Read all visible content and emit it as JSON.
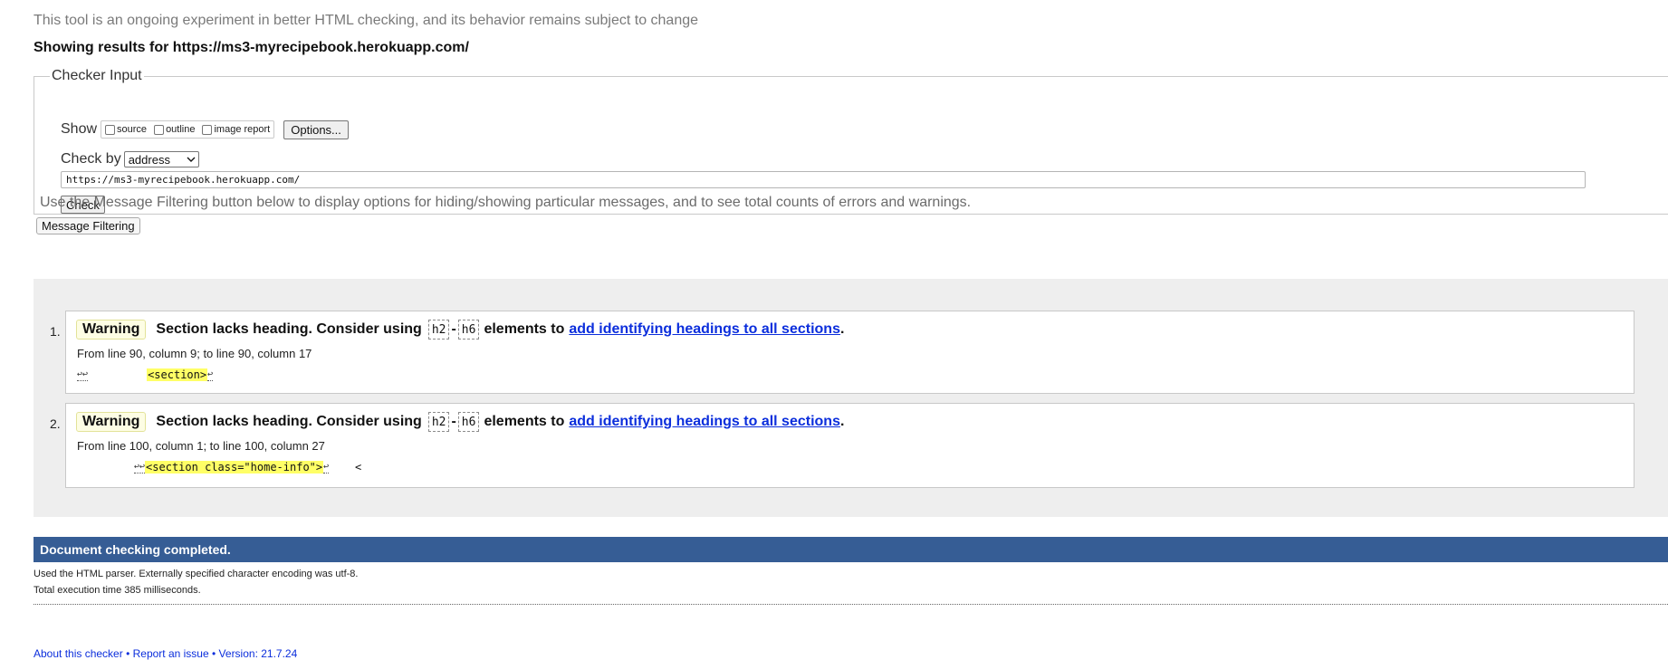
{
  "page": {
    "notice": "This tool is an ongoing experiment in better HTML checking, and its behavior remains subject to change",
    "results_for": "Showing results for https://ms3-myrecipebook.herokuapp.com/"
  },
  "checker": {
    "legend": "Checker Input",
    "show_label": "Show",
    "options": [
      {
        "label": "source",
        "checked": false
      },
      {
        "label": "outline",
        "checked": false
      },
      {
        "label": "image report",
        "checked": false
      }
    ],
    "options_button": "Options...",
    "check_by_label": "Check by",
    "check_by_value": "address",
    "url_value": "https://ms3-myrecipebook.herokuapp.com/",
    "check_button": "Check"
  },
  "filtering": {
    "hint": "Use the Message Filtering button below to display options for hiding/showing particular messages, and to see total counts of errors and warnings.",
    "button": "Message Filtering"
  },
  "messages": [
    {
      "number": "1.",
      "type": "Warning",
      "text_before": "Section lacks heading. Consider using",
      "code_a": "h2",
      "dash": "-",
      "code_b": "h6",
      "text_mid": "elements to",
      "link": "add identifying headings to all sections",
      "period": ".",
      "location": "From line 90, column 9; to line 90, column 17",
      "extract_pre_lf": "↩↩",
      "extract_pre_ws": "         ",
      "extract_highlight": "<section>",
      "extract_post_lf": "↩",
      "extract_post": ""
    },
    {
      "number": "2.",
      "type": "Warning",
      "text_before": "Section lacks heading. Consider using",
      "code_a": "h2",
      "dash": "-",
      "code_b": "h6",
      "text_mid": "elements to",
      "link": "add identifying headings to all sections",
      "period": ".",
      "location": "From line 100, column 1; to line 100, column 27",
      "extract_pre_lf": "↩↩",
      "extract_pre_ws": "",
      "extract_highlight": "<section class=\"home-info\">",
      "extract_post_lf": "↩",
      "extract_post": "    <"
    }
  ],
  "status": {
    "completed": "Document checking completed.",
    "parser_info": "Used the HTML parser. Externally specified character encoding was utf-8.",
    "execution_time": "Total execution time 385 milliseconds."
  },
  "footer": {
    "about": "About this checker",
    "report": "Report an issue",
    "version": "Version: 21.7.24"
  }
}
